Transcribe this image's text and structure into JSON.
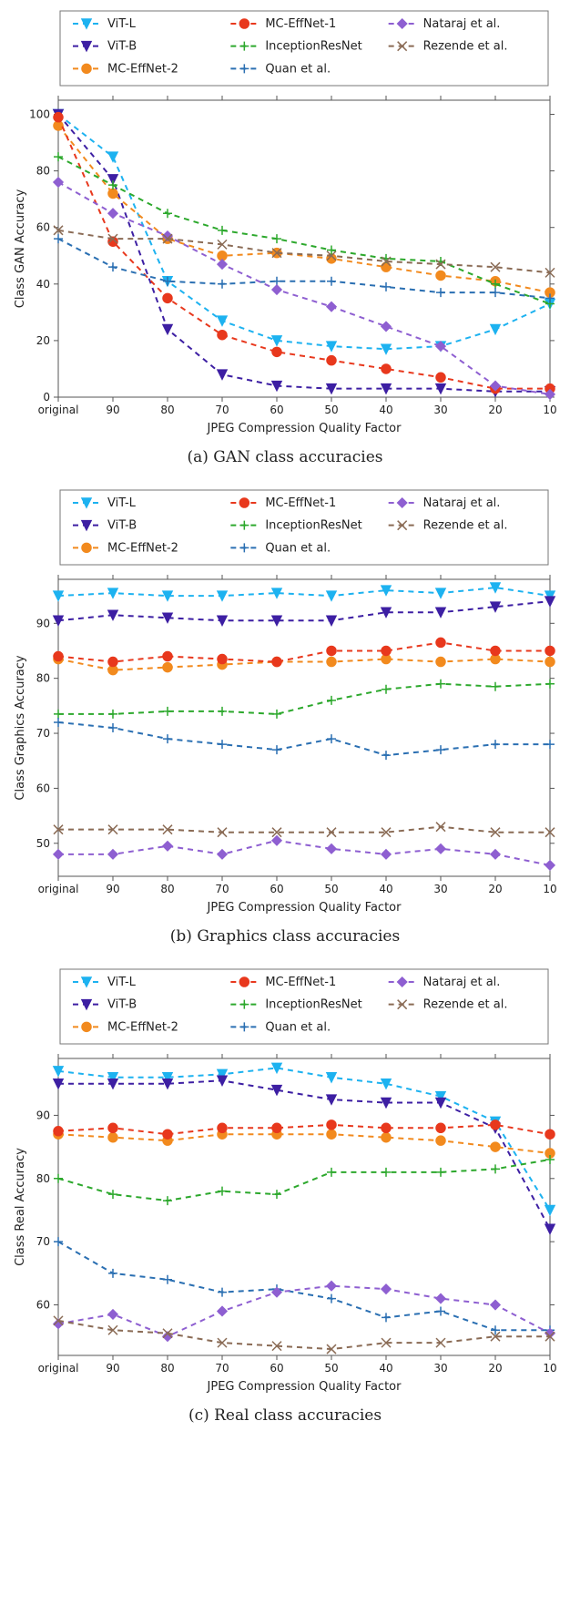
{
  "legend_order": [
    "ViT-L",
    "ViT-B",
    "MC-EffNet-2",
    "MC-EffNet-1",
    "InceptionResNet",
    "Quan et al.",
    "Nataraj et al.",
    "Rezende et al."
  ],
  "series_meta": {
    "ViT-L": {
      "color": "#1db2f0",
      "marker": "tri-down"
    },
    "ViT-B": {
      "color": "#3d1fa3",
      "marker": "tri-down"
    },
    "MC-EffNet-2": {
      "color": "#f28a1e",
      "marker": "circle"
    },
    "MC-EffNet-1": {
      "color": "#e8381d",
      "marker": "circle"
    },
    "InceptionResNet": {
      "color": "#2ca82c",
      "marker": "plus"
    },
    "Quan et al.": {
      "color": "#2a6fb2",
      "marker": "plus"
    },
    "Nataraj et al.": {
      "color": "#8e5fd1",
      "marker": "diamond"
    },
    "Rezende et al.": {
      "color": "#8a6b55",
      "marker": "x"
    }
  },
  "categories": [
    "original",
    "90",
    "80",
    "70",
    "60",
    "50",
    "40",
    "30",
    "20",
    "10"
  ],
  "captions": {
    "a": "(a) GAN class accuracies",
    "b": "(b) Graphics class accuracies",
    "c": "(c) Real class accuracies"
  },
  "chart_data": [
    {
      "id": "a",
      "type": "line",
      "title": "",
      "xlabel": "JPEG Compression Quality Factor",
      "ylabel": "Class GAN Accuracy",
      "ylim": [
        0,
        105
      ],
      "yticks": [
        0,
        20,
        40,
        60,
        80,
        100
      ],
      "categories": [
        "original",
        "90",
        "80",
        "70",
        "60",
        "50",
        "40",
        "30",
        "20",
        "10"
      ],
      "series": [
        {
          "name": "ViT-L",
          "values": [
            100,
            85,
            41,
            27,
            20,
            18,
            17,
            18,
            24,
            33
          ]
        },
        {
          "name": "ViT-B",
          "values": [
            100,
            77,
            24,
            8,
            4,
            3,
            3,
            3,
            2,
            2
          ]
        },
        {
          "name": "MC-EffNet-2",
          "values": [
            96,
            72,
            56,
            50,
            51,
            49,
            46,
            43,
            41,
            37
          ]
        },
        {
          "name": "MC-EffNet-1",
          "values": [
            99,
            55,
            35,
            22,
            16,
            13,
            10,
            7,
            3,
            3
          ]
        },
        {
          "name": "InceptionResNet",
          "values": [
            85,
            75,
            65,
            59,
            56,
            52,
            49,
            48,
            40,
            33
          ]
        },
        {
          "name": "Quan et al.",
          "values": [
            56,
            46,
            41,
            40,
            41,
            41,
            39,
            37,
            37,
            35
          ]
        },
        {
          "name": "Nataraj et al.",
          "values": [
            76,
            65,
            57,
            47,
            38,
            32,
            25,
            18,
            4,
            1
          ]
        },
        {
          "name": "Rezende et al.",
          "values": [
            59,
            56,
            56,
            54,
            51,
            50,
            48,
            47,
            46,
            44
          ]
        }
      ]
    },
    {
      "id": "b",
      "type": "line",
      "title": "",
      "xlabel": "JPEG Compression Quality Factor",
      "ylabel": "Class Graphics Accuracy",
      "ylim": [
        44,
        98
      ],
      "yticks": [
        50,
        60,
        70,
        80,
        90
      ],
      "categories": [
        "original",
        "90",
        "80",
        "70",
        "60",
        "50",
        "40",
        "30",
        "20",
        "10"
      ],
      "series": [
        {
          "name": "ViT-L",
          "values": [
            95,
            95.5,
            95,
            95,
            95.5,
            95,
            96,
            95.5,
            96.5,
            95
          ]
        },
        {
          "name": "ViT-B",
          "values": [
            90.5,
            91.5,
            91,
            90.5,
            90.5,
            90.5,
            92,
            92,
            93,
            94
          ]
        },
        {
          "name": "MC-EffNet-2",
          "values": [
            83.5,
            81.5,
            82,
            82.5,
            83,
            83,
            83.5,
            83,
            83.5,
            83
          ]
        },
        {
          "name": "MC-EffNet-1",
          "values": [
            84,
            83,
            84,
            83.5,
            83,
            85,
            85,
            86.5,
            85,
            85
          ]
        },
        {
          "name": "InceptionResNet",
          "values": [
            73.5,
            73.5,
            74,
            74,
            73.5,
            76,
            78,
            79,
            78.5,
            79
          ]
        },
        {
          "name": "Quan et al.",
          "values": [
            72,
            71,
            69,
            68,
            67,
            69,
            66,
            67,
            68,
            68
          ]
        },
        {
          "name": "Nataraj et al.",
          "values": [
            48,
            48,
            49.5,
            48,
            50.5,
            49,
            48,
            49,
            48,
            46
          ]
        },
        {
          "name": "Rezende et al.",
          "values": [
            52.5,
            52.5,
            52.5,
            52,
            52,
            52,
            52,
            53,
            52,
            52
          ]
        }
      ]
    },
    {
      "id": "c",
      "type": "line",
      "title": "",
      "xlabel": "JPEG Compression Quality Factor",
      "ylabel": "Class Real Accuracy",
      "ylim": [
        52,
        99
      ],
      "yticks": [
        60,
        70,
        80,
        90
      ],
      "categories": [
        "original",
        "90",
        "80",
        "70",
        "60",
        "50",
        "40",
        "30",
        "20",
        "10"
      ],
      "series": [
        {
          "name": "ViT-L",
          "values": [
            97,
            96,
            96,
            96.5,
            97.5,
            96,
            95,
            93,
            89,
            75
          ]
        },
        {
          "name": "ViT-B",
          "values": [
            95,
            95,
            95,
            95.5,
            94,
            92.5,
            92,
            92,
            88,
            72
          ]
        },
        {
          "name": "MC-EffNet-2",
          "values": [
            87,
            86.5,
            86,
            87,
            87,
            87,
            86.5,
            86,
            85,
            84
          ]
        },
        {
          "name": "MC-EffNet-1",
          "values": [
            87.5,
            88,
            87,
            88,
            88,
            88.5,
            88,
            88,
            88.5,
            87
          ]
        },
        {
          "name": "InceptionResNet",
          "values": [
            80,
            77.5,
            76.5,
            78,
            77.5,
            81,
            81,
            81,
            81.5,
            83
          ]
        },
        {
          "name": "Quan et al.",
          "values": [
            70,
            65,
            64,
            62,
            62.5,
            61,
            58,
            59,
            56,
            56
          ]
        },
        {
          "name": "Nataraj et al.",
          "values": [
            57,
            58.5,
            55,
            59,
            62,
            63,
            62.5,
            61,
            60,
            55.5
          ]
        },
        {
          "name": "Rezende et al.",
          "values": [
            57.5,
            56,
            55.5,
            54,
            53.5,
            53,
            54,
            54,
            55,
            55
          ]
        }
      ]
    }
  ]
}
